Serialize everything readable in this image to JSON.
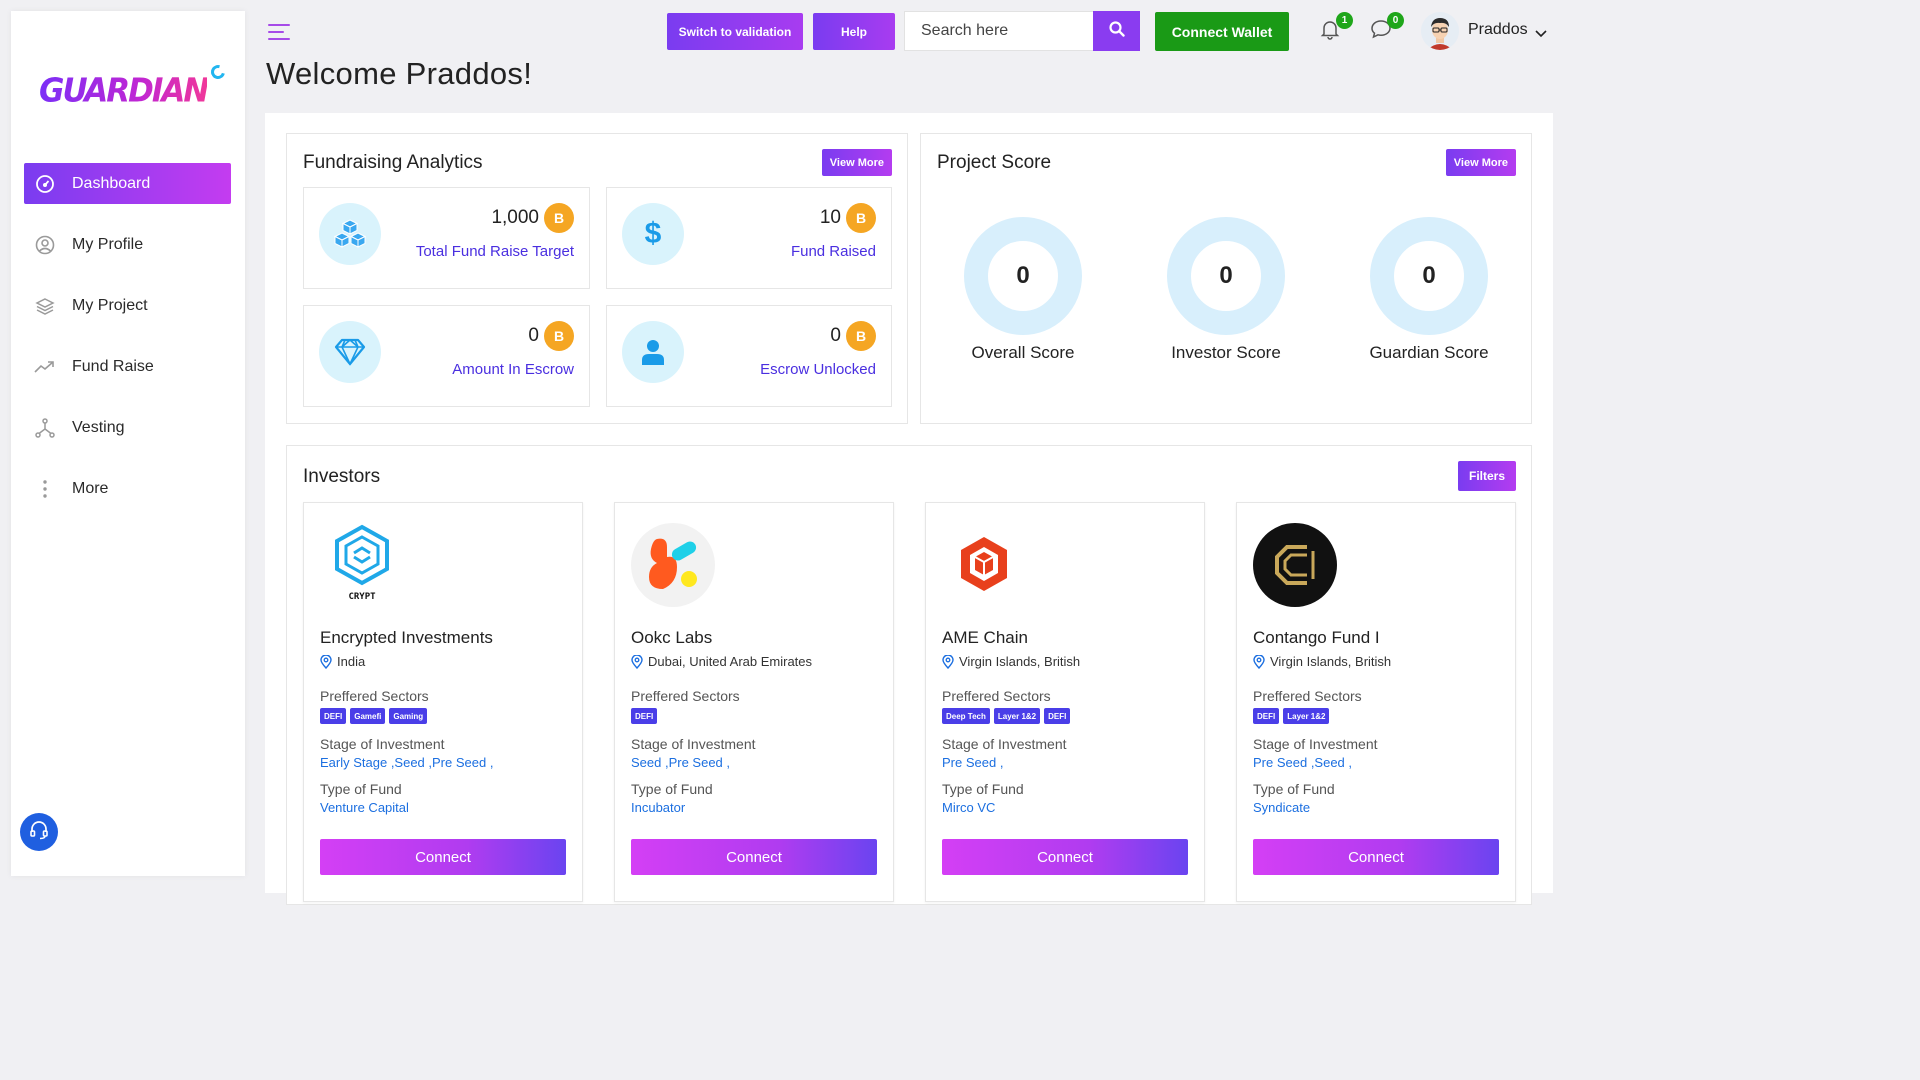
{
  "brand": {
    "logo_text": "GUARDIAN"
  },
  "sidebar": {
    "items": [
      {
        "label": "Dashboard",
        "icon": "dashboard-gauge-icon",
        "active": true
      },
      {
        "label": "My Profile",
        "icon": "user-circle-icon"
      },
      {
        "label": "My Project",
        "icon": "layers-icon"
      },
      {
        "label": "Fund Raise",
        "icon": "trending-up-icon"
      },
      {
        "label": "Vesting",
        "icon": "branch-icon"
      },
      {
        "label": "More",
        "icon": "vertical-dots-icon"
      }
    ],
    "support_icon": "headset-icon"
  },
  "header": {
    "title": "Welcome Praddos!",
    "switch_label": "Switch to validation",
    "help_label": "Help",
    "search_placeholder": "Search here",
    "wallet_label": "Connect Wallet",
    "notifications_count": "1",
    "messages_count": "0",
    "user_name": "Praddos"
  },
  "fundraising": {
    "title": "Fundraising Analytics",
    "view_more": "View More",
    "stats": [
      {
        "value": "1,000",
        "label": "Total Fund Raise Target",
        "icon": "cubes-icon"
      },
      {
        "value": "10",
        "label": "Fund Raised",
        "icon": "dollar-icon"
      },
      {
        "value": "0",
        "label": "Amount In Escrow",
        "icon": "diamond-icon"
      },
      {
        "value": "0",
        "label": "Escrow Unlocked",
        "icon": "user-icon"
      }
    ]
  },
  "project_score": {
    "title": "Project Score",
    "view_more": "View More",
    "scores": [
      {
        "value": "0",
        "label": "Overall Score"
      },
      {
        "value": "0",
        "label": "Investor Score"
      },
      {
        "value": "0",
        "label": "Guardian Score"
      }
    ]
  },
  "investors": {
    "title": "Investors",
    "filters_label": "Filters",
    "sectors_label": "Preffered Sectors",
    "stage_label": "Stage of Investment",
    "type_label": "Type of Fund",
    "connect_label": "Connect",
    "cards": [
      {
        "name": "Encrypted Investments",
        "location": "India",
        "logo_text": "CRYPT",
        "tags": [
          "DEFI",
          "Gamefi",
          "Gaming"
        ],
        "stage": "Early Stage ,Seed ,Pre Seed ,",
        "type": "Venture Capital"
      },
      {
        "name": "Ookc Labs",
        "location": "Dubai, United Arab Emirates",
        "tags": [
          "DEFI"
        ],
        "stage": "Seed ,Pre Seed ,",
        "type": "Incubator"
      },
      {
        "name": "AME Chain",
        "location": "Virgin Islands, British",
        "tags": [
          "Deep Tech",
          "Layer 1&2",
          "DEFI"
        ],
        "stage": "Pre Seed ,",
        "type": "Mirco VC"
      },
      {
        "name": "Contango Fund I",
        "location": "Virgin Islands, British",
        "tags": [
          "DEFI",
          "Layer 1&2"
        ],
        "stage": "Pre Seed ,Seed ,",
        "type": "Syndicate"
      }
    ]
  }
}
